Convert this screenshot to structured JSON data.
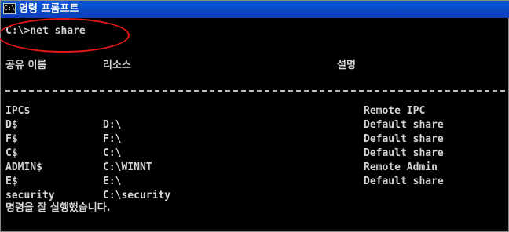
{
  "window": {
    "title": "명령 프롬프트",
    "icon": "cmd-icon"
  },
  "console": {
    "command_line": "C:\\>net share",
    "headers": {
      "name": "공유 이름",
      "resource": "리소스",
      "remark": "설명"
    },
    "rows": [
      {
        "name": "IPC$",
        "resource": "",
        "remark": "Remote IPC"
      },
      {
        "name": "D$",
        "resource": "D:\\",
        "remark": "Default share"
      },
      {
        "name": "F$",
        "resource": "F:\\",
        "remark": "Default share"
      },
      {
        "name": "C$",
        "resource": "C:\\",
        "remark": "Default share"
      },
      {
        "name": "ADMIN$",
        "resource": "C:\\WINNT",
        "remark": "Remote Admin"
      },
      {
        "name": "E$",
        "resource": "E:\\",
        "remark": "Default share"
      },
      {
        "name": "security",
        "resource": "C:\\security",
        "remark": ""
      }
    ],
    "completion_message": "명령을 잘 실행했습니다."
  },
  "annotation": {
    "color": "#e01818",
    "shape": "ellipse"
  }
}
